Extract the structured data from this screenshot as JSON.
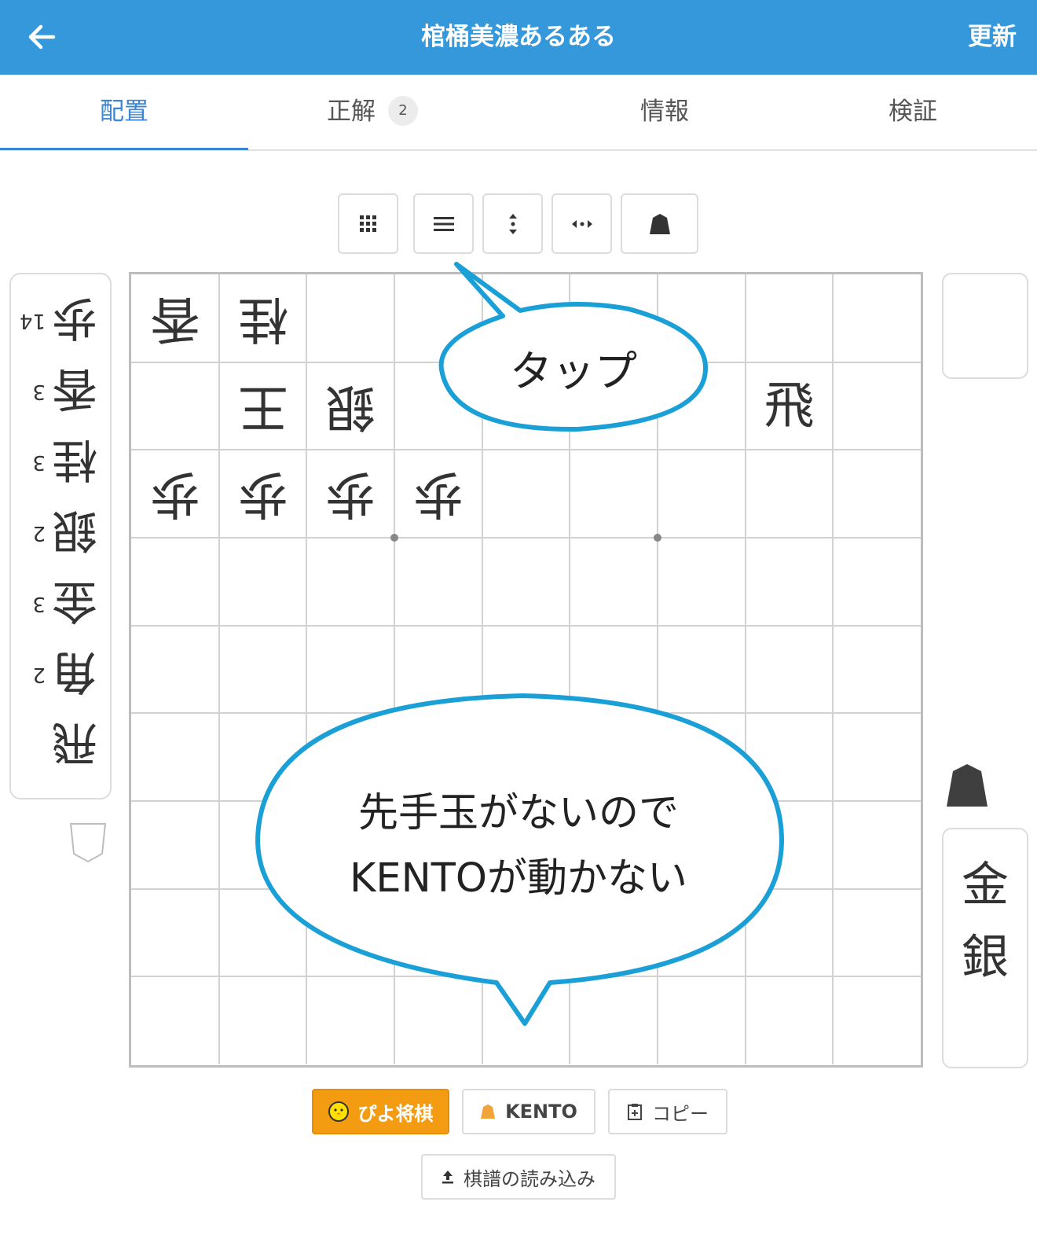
{
  "header": {
    "title": "棺桶美濃あるある",
    "refresh_label": "更新",
    "back_icon": "arrow-left-icon"
  },
  "tabs": [
    {
      "label": "配置",
      "active": true
    },
    {
      "label": "正解",
      "badge": "2"
    },
    {
      "label": "情報"
    },
    {
      "label": "検証"
    }
  ],
  "toolbar": [
    "grid-icon",
    "menu-icon",
    "flip-vertical-icon",
    "flip-horizontal-icon",
    "piece-icon"
  ],
  "gote_hand": [
    {
      "piece": "歩",
      "count": "14"
    },
    {
      "piece": "香",
      "count": "3"
    },
    {
      "piece": "桂",
      "count": "3"
    },
    {
      "piece": "銀",
      "count": "2"
    },
    {
      "piece": "金",
      "count": "3"
    },
    {
      "piece": "角",
      "count": "2"
    },
    {
      "piece": "飛",
      "count": ""
    }
  ],
  "board": {
    "pieces": [
      {
        "file": 9,
        "rank": 1,
        "piece": "香",
        "side": "gote"
      },
      {
        "file": 8,
        "rank": 1,
        "piece": "桂",
        "side": "gote"
      },
      {
        "file": 8,
        "rank": 2,
        "piece": "王",
        "side": "gote"
      },
      {
        "file": 7,
        "rank": 2,
        "piece": "銀",
        "side": "gote"
      },
      {
        "file": 2,
        "rank": 2,
        "piece": "飛",
        "side": "sente"
      },
      {
        "file": 9,
        "rank": 3,
        "piece": "歩",
        "side": "gote"
      },
      {
        "file": 8,
        "rank": 3,
        "piece": "歩",
        "side": "gote"
      },
      {
        "file": 7,
        "rank": 3,
        "piece": "歩",
        "side": "gote"
      },
      {
        "file": 6,
        "rank": 3,
        "piece": "歩",
        "side": "gote"
      }
    ]
  },
  "sente_hand": [
    {
      "piece": "金"
    },
    {
      "piece": "銀"
    }
  ],
  "callouts": {
    "tap": "タップ",
    "kento_line1": "先手玉がないので",
    "kento_line2": "KENTOが動かない"
  },
  "buttons": {
    "piyo": "ぴよ将棋",
    "kento": "KENTO",
    "copy": "コピー",
    "load": "棋譜の読み込み"
  },
  "colors": {
    "accent": "#3498db",
    "tab_active": "#3a86d4",
    "piyo": "#f39c12",
    "callout_stroke": "#1aa0d6"
  }
}
